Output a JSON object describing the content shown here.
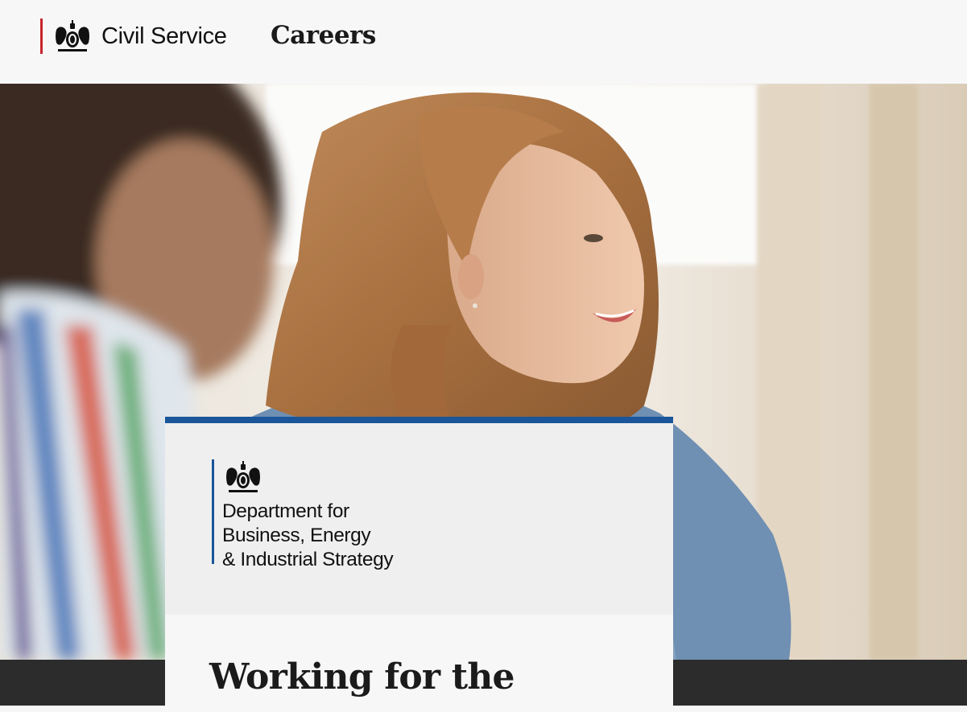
{
  "header": {
    "brand_name": "Civil Service",
    "careers_label": "Careers",
    "crest_icon": "royal-coat-of-arms-icon"
  },
  "hero": {
    "image": "photo-smiling-woman-icon"
  },
  "card": {
    "department_lines": [
      "Department for",
      "Business, Energy",
      "& Industrial Strategy"
    ],
    "heading": "Working for the",
    "accent_color": "#1a5699"
  },
  "colors": {
    "brand_rule": "#c8252c",
    "dark_band": "#2c2c2c"
  }
}
